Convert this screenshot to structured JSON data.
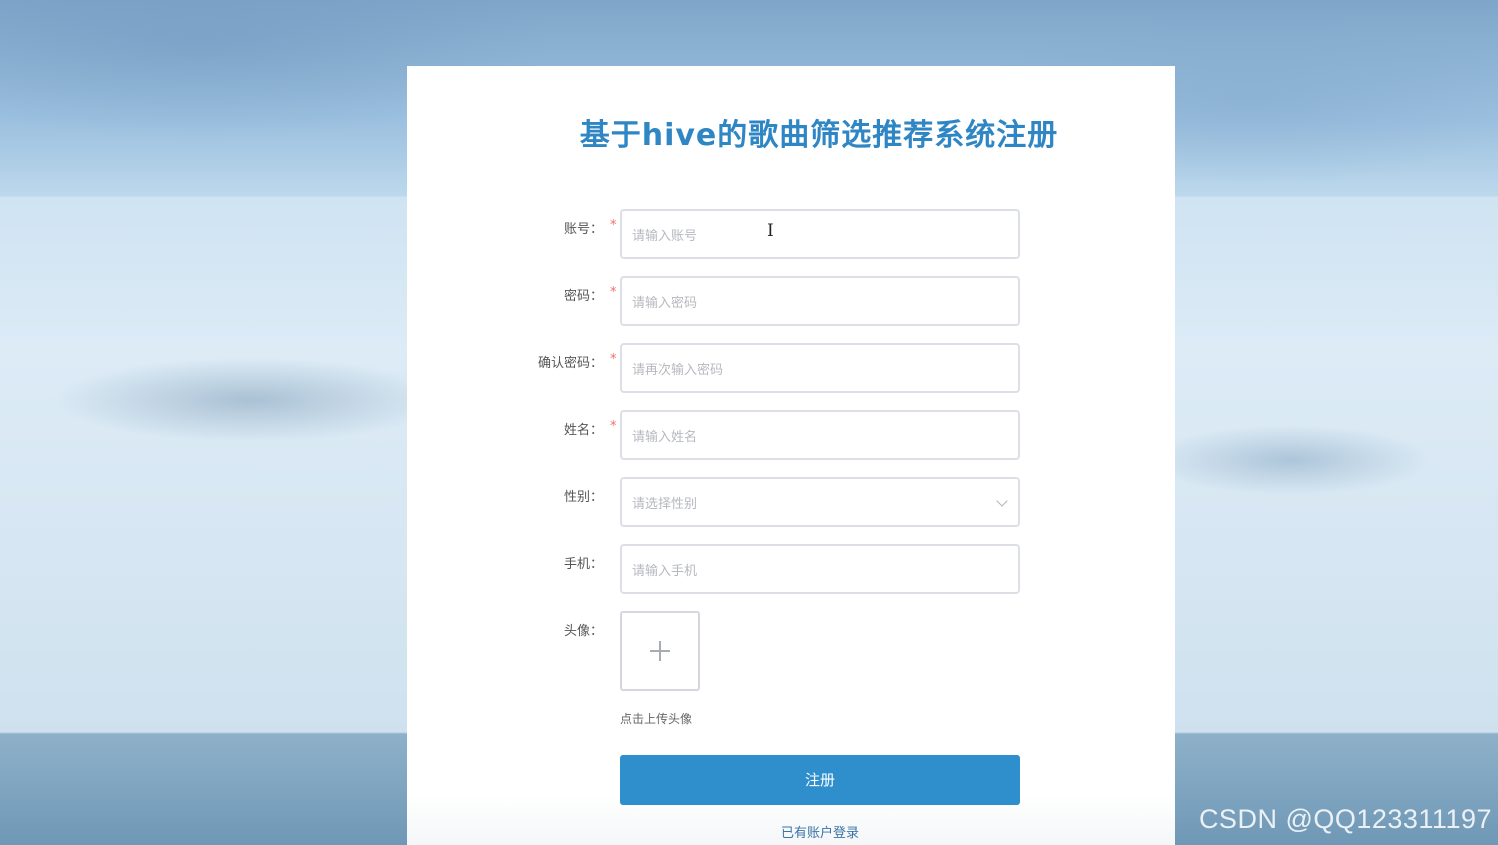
{
  "page": {
    "title": "基于hive的歌曲筛选推荐系统注册"
  },
  "form": {
    "fields": [
      {
        "label": "账号：",
        "required": "*",
        "placeholder": "请输入账号"
      },
      {
        "label": "密码：",
        "required": "*",
        "placeholder": "请输入密码"
      },
      {
        "label": "确认密码：",
        "required": "*",
        "placeholder": "请再次输入密码"
      },
      {
        "label": "姓名：",
        "required": "*",
        "placeholder": "请输入姓名"
      },
      {
        "label": "性别：",
        "required": "",
        "placeholder": "请选择性别"
      },
      {
        "label": "手机：",
        "required": "",
        "placeholder": "请输入手机"
      }
    ],
    "avatar": {
      "label": "头像：",
      "tip": "点击上传头像"
    },
    "submit_label": "注册",
    "login_link": "已有账户登录"
  },
  "watermark": "CSDN @QQ123311197",
  "colors": {
    "title": "#2f86c4",
    "button": "#2f8fcd",
    "required": "#f56c6c",
    "link": "#3a73a8"
  },
  "icons": {
    "gender_dropdown": "chevron-down-icon",
    "avatar_upload": "plus-icon",
    "text_cursor": "text-cursor-icon"
  }
}
